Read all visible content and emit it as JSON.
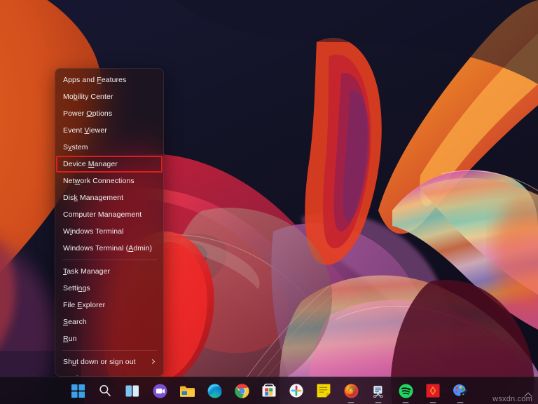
{
  "desktop": {
    "wallpaper_name": "windows-11-flow-abstract-wallpaper",
    "background_color": "#14142a",
    "accent_colors": [
      "#e8531f",
      "#c42a3c",
      "#8e3a6e",
      "#f08a3c",
      "#e8a0d8",
      "#6ad0c0"
    ]
  },
  "context_menu": {
    "name": "win-x-power-user-menu",
    "highlight_color": "#e21b1b",
    "items": [
      {
        "id": "apps-and-features",
        "label": "Apps and Features",
        "accel": "F",
        "selected": false,
        "submenu": false,
        "separator_after": false
      },
      {
        "id": "mobility-center",
        "label": "Mobility Center",
        "accel": "b",
        "selected": false,
        "submenu": false,
        "separator_after": false
      },
      {
        "id": "power-options",
        "label": "Power Options",
        "accel": "O",
        "selected": false,
        "submenu": false,
        "separator_after": false
      },
      {
        "id": "event-viewer",
        "label": "Event Viewer",
        "accel": "V",
        "selected": false,
        "submenu": false,
        "separator_after": false
      },
      {
        "id": "system",
        "label": "System",
        "accel": "y",
        "selected": false,
        "submenu": false,
        "separator_after": false
      },
      {
        "id": "device-manager",
        "label": "Device Manager",
        "accel": "M",
        "selected": true,
        "submenu": false,
        "separator_after": false
      },
      {
        "id": "network-connections",
        "label": "Network Connections",
        "accel": "w",
        "selected": false,
        "submenu": false,
        "separator_after": false
      },
      {
        "id": "disk-management",
        "label": "Disk Management",
        "accel": "k",
        "selected": false,
        "submenu": false,
        "separator_after": false
      },
      {
        "id": "computer-management",
        "label": "Computer Management",
        "accel": "g",
        "selected": false,
        "submenu": false,
        "separator_after": false
      },
      {
        "id": "windows-terminal",
        "label": "Windows Terminal",
        "accel": "i",
        "selected": false,
        "submenu": false,
        "separator_after": false
      },
      {
        "id": "windows-terminal-admin",
        "label": "Windows Terminal (Admin)",
        "accel": "A",
        "selected": false,
        "submenu": false,
        "separator_after": true
      },
      {
        "id": "task-manager",
        "label": "Task Manager",
        "accel": "T",
        "selected": false,
        "submenu": false,
        "separator_after": false
      },
      {
        "id": "settings",
        "label": "Settings",
        "accel": "n",
        "selected": false,
        "submenu": false,
        "separator_after": false
      },
      {
        "id": "file-explorer",
        "label": "File Explorer",
        "accel": "E",
        "selected": false,
        "submenu": false,
        "separator_after": false
      },
      {
        "id": "search",
        "label": "Search",
        "accel": "S",
        "selected": false,
        "submenu": false,
        "separator_after": false
      },
      {
        "id": "run",
        "label": "Run",
        "accel": "R",
        "selected": false,
        "submenu": false,
        "separator_after": true
      },
      {
        "id": "shut-down-or-sign-out",
        "label": "Shut down or sign out",
        "accel": "u",
        "selected": false,
        "submenu": true,
        "separator_after": false
      },
      {
        "id": "desktop",
        "label": "Desktop",
        "accel": "D",
        "selected": false,
        "submenu": false,
        "separator_after": false
      }
    ]
  },
  "taskbar": {
    "background_color": "#100c14",
    "icons": [
      {
        "id": "start",
        "name": "windows-start-icon",
        "label": "Start",
        "running": false
      },
      {
        "id": "search",
        "name": "search-icon",
        "label": "Search",
        "running": false
      },
      {
        "id": "task-view",
        "name": "task-view-icon",
        "label": "Task View",
        "running": false
      },
      {
        "id": "chat",
        "name": "chat-teams-icon",
        "label": "Chat",
        "running": false
      },
      {
        "id": "file-explorer",
        "name": "file-explorer-folder-icon",
        "label": "File Explorer",
        "running": false
      },
      {
        "id": "edge",
        "name": "microsoft-edge-icon",
        "label": "Microsoft Edge",
        "running": false
      },
      {
        "id": "chrome",
        "name": "google-chrome-icon",
        "label": "Google Chrome",
        "running": false
      },
      {
        "id": "store",
        "name": "microsoft-store-icon",
        "label": "Microsoft Store",
        "running": false
      },
      {
        "id": "slack",
        "name": "slack-icon",
        "label": "Slack",
        "running": false
      },
      {
        "id": "sticky-notes",
        "name": "sticky-notes-icon",
        "label": "Sticky Notes",
        "running": false
      },
      {
        "id": "firefox",
        "name": "firefox-icon",
        "label": "Firefox",
        "running": true
      },
      {
        "id": "snipping-tool",
        "name": "snipping-tool-icon",
        "label": "Snipping Tool",
        "running": true
      },
      {
        "id": "spotify",
        "name": "spotify-icon",
        "label": "Spotify",
        "running": true
      },
      {
        "id": "red-app",
        "name": "red-diamond-app-icon",
        "label": "App",
        "running": true
      },
      {
        "id": "paint-app",
        "name": "paint-palette-app-icon",
        "label": "Paint",
        "running": true
      }
    ],
    "tray": {
      "show_hidden_icons": "show-hidden-icons-chevron"
    }
  },
  "watermark": {
    "text": "wsxdn.com"
  }
}
